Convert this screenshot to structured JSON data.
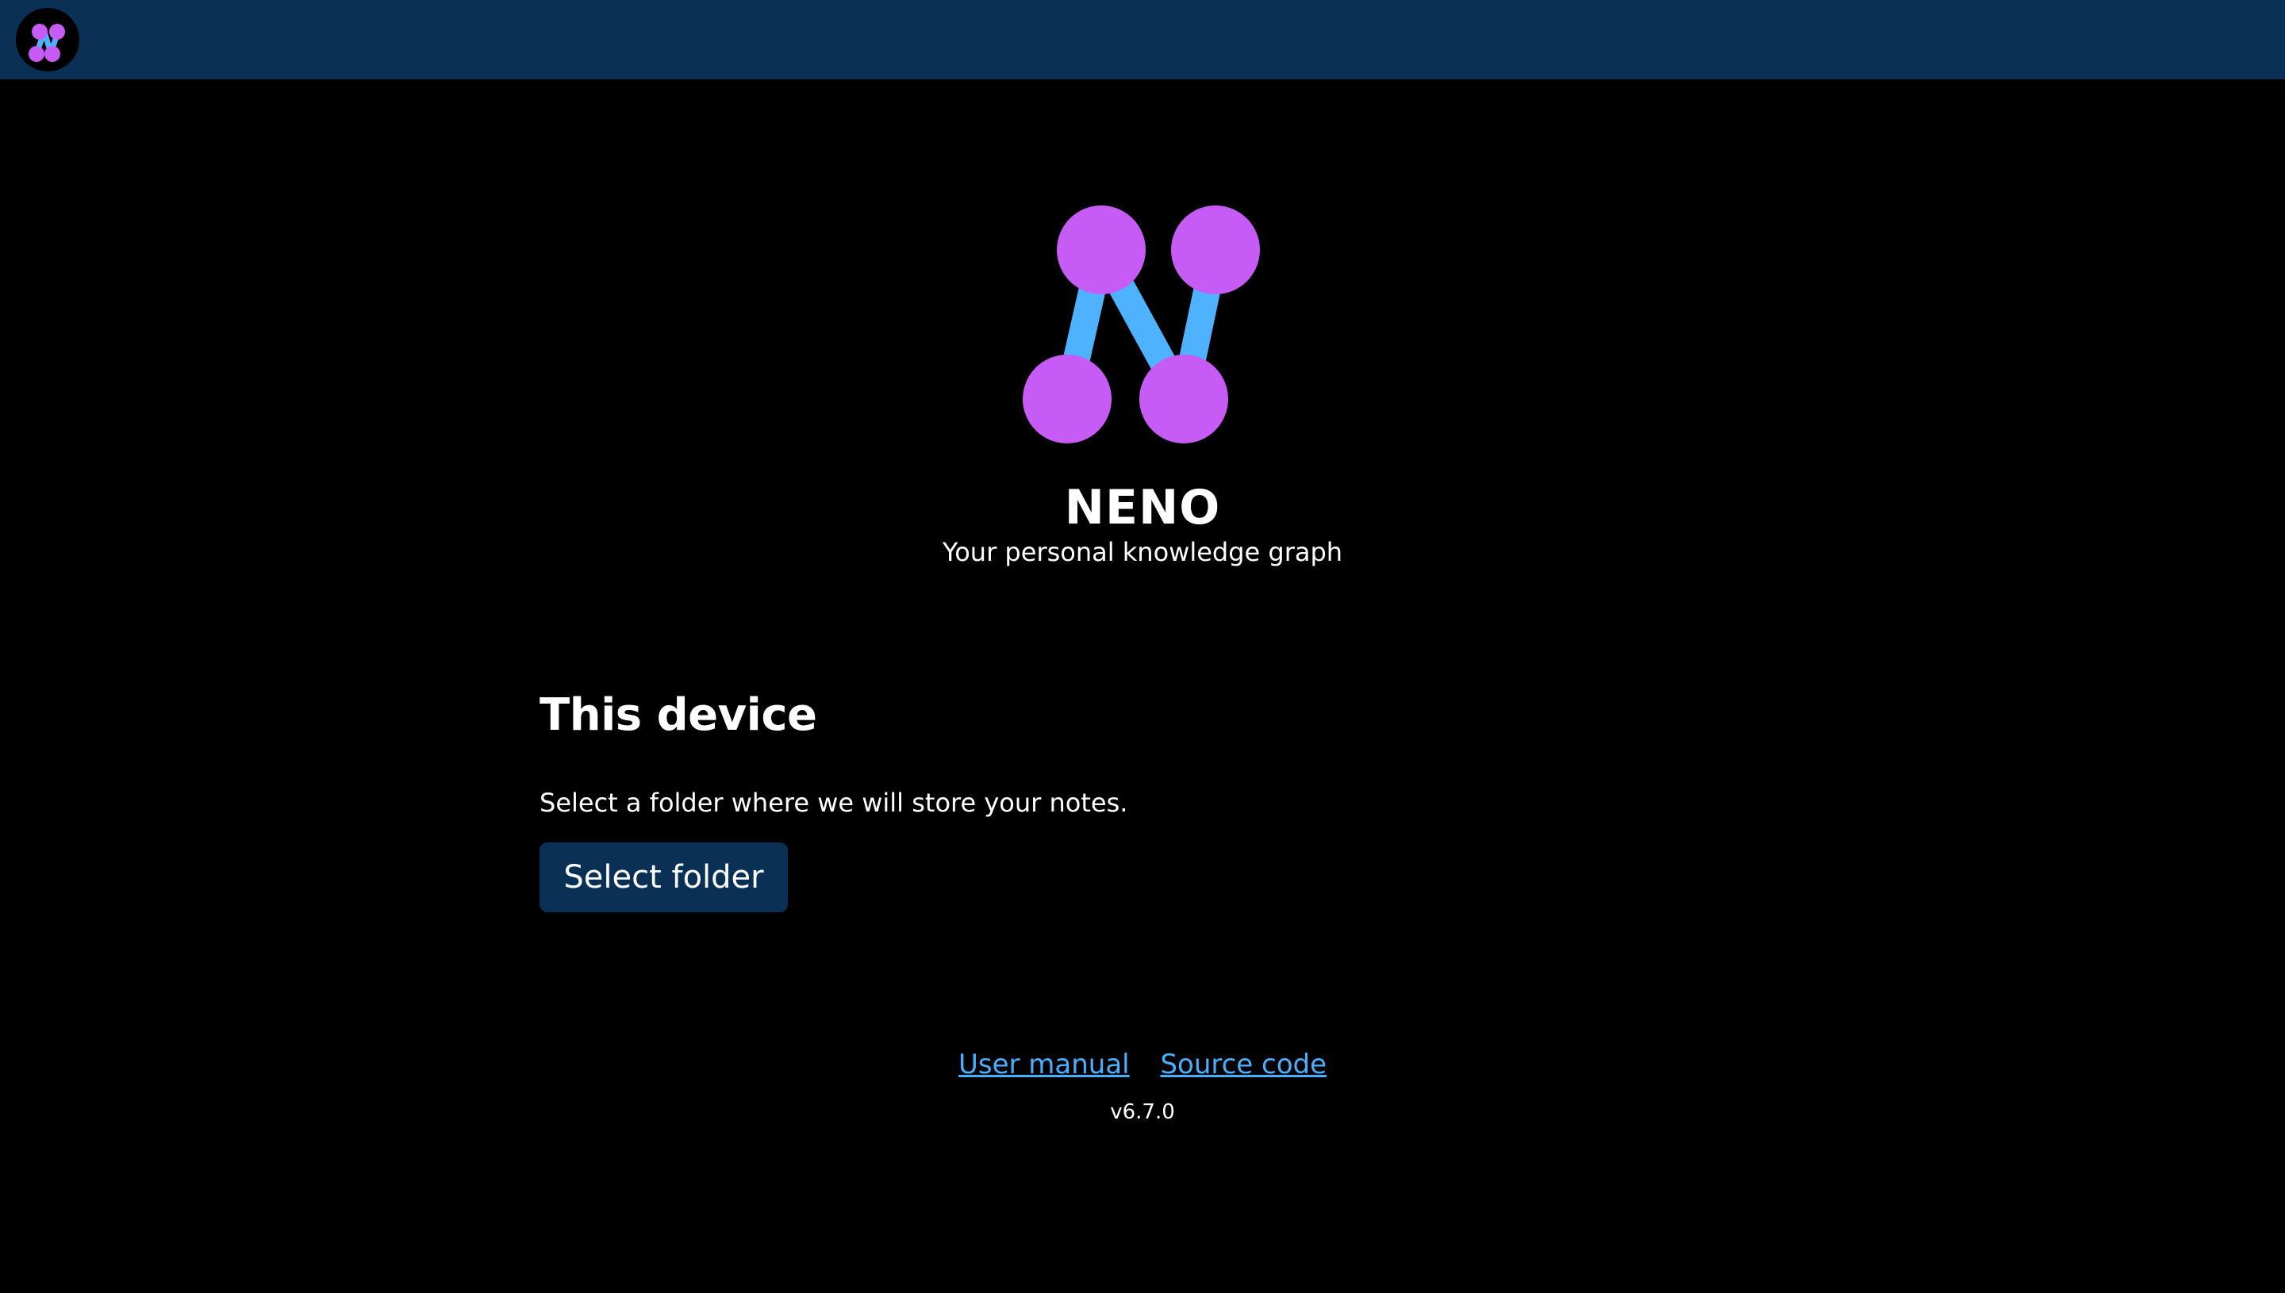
{
  "header": {
    "logo_icon": "neno-logo-icon"
  },
  "hero": {
    "logo_icon": "neno-logo-icon",
    "app_name": "NENO",
    "tagline": "Your personal knowledge graph"
  },
  "storage": {
    "title": "This device",
    "description": "Select a folder where we will store your notes.",
    "select_folder_label": "Select folder"
  },
  "footer": {
    "user_manual_label": "User manual",
    "source_code_label": "Source code",
    "version": "v6.7.0"
  },
  "colors": {
    "background": "#000000",
    "header_bg": "#0a3055",
    "button_bg": "#0a3055",
    "link": "#48b0ff",
    "logo_node": "#c65cf5",
    "logo_edge": "#4eb2ff"
  }
}
